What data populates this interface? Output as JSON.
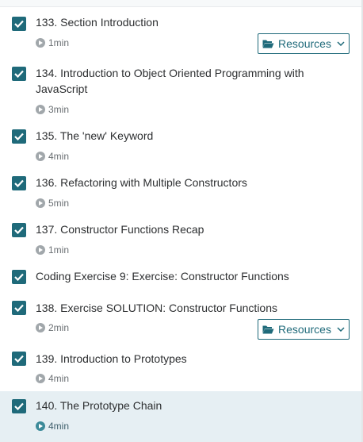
{
  "lectures": [
    {
      "title": "133. Section Introduction",
      "duration": "1min",
      "has_resources": true,
      "completed": true
    },
    {
      "title": "134. Introduction to Object Oriented Programming with JavaScript",
      "duration": "3min",
      "has_resources": false,
      "completed": true
    },
    {
      "title": "135. The 'new' Keyword",
      "duration": "4min",
      "has_resources": false,
      "completed": true
    },
    {
      "title": "136. Refactoring with Multiple Constructors",
      "duration": "5min",
      "has_resources": false,
      "completed": true
    },
    {
      "title": "137. Constructor Functions Recap",
      "duration": "1min",
      "has_resources": false,
      "completed": true
    },
    {
      "title": "Coding Exercise 9: Exercise: Constructor Functions",
      "duration": "",
      "has_resources": false,
      "completed": true
    },
    {
      "title": "138. Exercise SOLUTION: Constructor Functions",
      "duration": "2min",
      "has_resources": true,
      "completed": true
    },
    {
      "title": "139. Introduction to Prototypes",
      "duration": "4min",
      "has_resources": false,
      "completed": true
    },
    {
      "title": "140. The Prototype Chain",
      "duration": "4min",
      "has_resources": false,
      "completed": true,
      "active": true
    }
  ],
  "resources_label": "Resources",
  "icons": {
    "checkbox": "checkbox-checked-icon",
    "play": "play-circle-icon",
    "folder": "folder-open-icon",
    "chevron": "chevron-down-icon"
  },
  "colors": {
    "accent": "#1f6a7a",
    "active_row": "#e6eff3",
    "meta_text": "#6a6f73"
  }
}
